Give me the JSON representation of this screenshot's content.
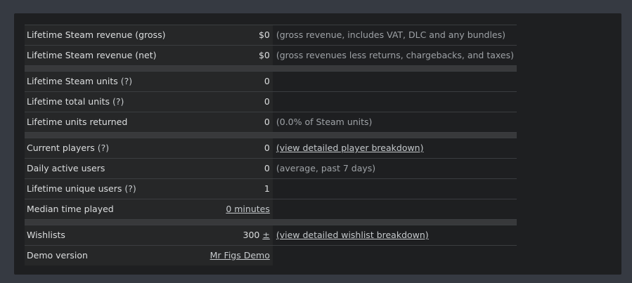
{
  "help_marker": "(?)",
  "rows": {
    "gross": {
      "label": "Lifetime Steam revenue (gross)",
      "value": "$0",
      "note": "(gross revenue, includes VAT, DLC and any bundles)"
    },
    "net": {
      "label": "Lifetime Steam revenue (net)",
      "value": "$0",
      "note": "(gross revenues less returns, chargebacks, and taxes)"
    },
    "steam_units": {
      "label": "Lifetime Steam units",
      "value": "0"
    },
    "total_units": {
      "label": "Lifetime total units",
      "value": "0"
    },
    "units_returned": {
      "label": "Lifetime units returned",
      "value": "0",
      "note": "(0.0% of Steam units)"
    },
    "current_players": {
      "label": "Current players",
      "value": "0",
      "link": "(view detailed player breakdown)"
    },
    "daily_active": {
      "label": "Daily active users",
      "value": "0",
      "note": "(average, past 7 days)"
    },
    "unique_users": {
      "label": "Lifetime unique users",
      "value": "1"
    },
    "median_time": {
      "label": "Median time played",
      "value_link": "0 minutes"
    },
    "wishlists": {
      "label": "Wishlists",
      "value": "300",
      "value_link": "±",
      "link": "(view detailed wishlist breakdown)"
    },
    "demo": {
      "label": "Demo version",
      "value_link": "Mr Figs Demo"
    }
  }
}
